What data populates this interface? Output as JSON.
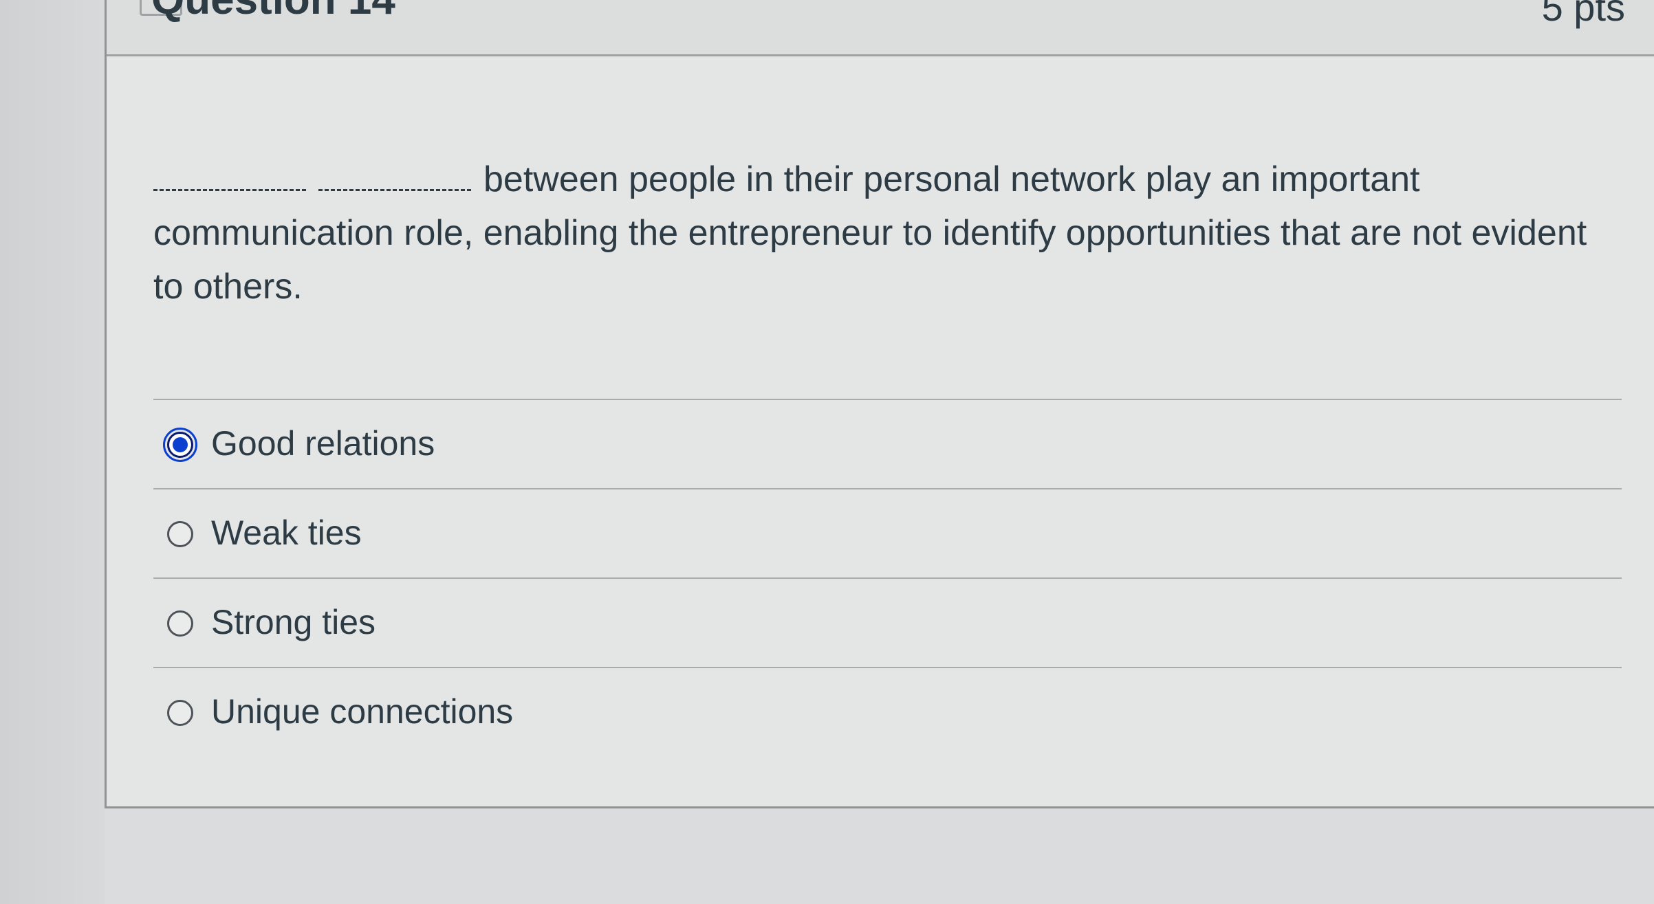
{
  "question": {
    "title": "Question 14",
    "points": "5 pts",
    "text": "between people in their personal network play an important communication role, enabling the entrepreneur to identify opportunities that are not evident to others."
  },
  "answers": [
    {
      "label": "Good relations",
      "selected": true
    },
    {
      "label": "Weak ties",
      "selected": false
    },
    {
      "label": "Strong ties",
      "selected": false
    },
    {
      "label": "Unique connections",
      "selected": false
    }
  ],
  "colors": {
    "accent": "#0b3fd0",
    "text": "#2d3b45"
  }
}
